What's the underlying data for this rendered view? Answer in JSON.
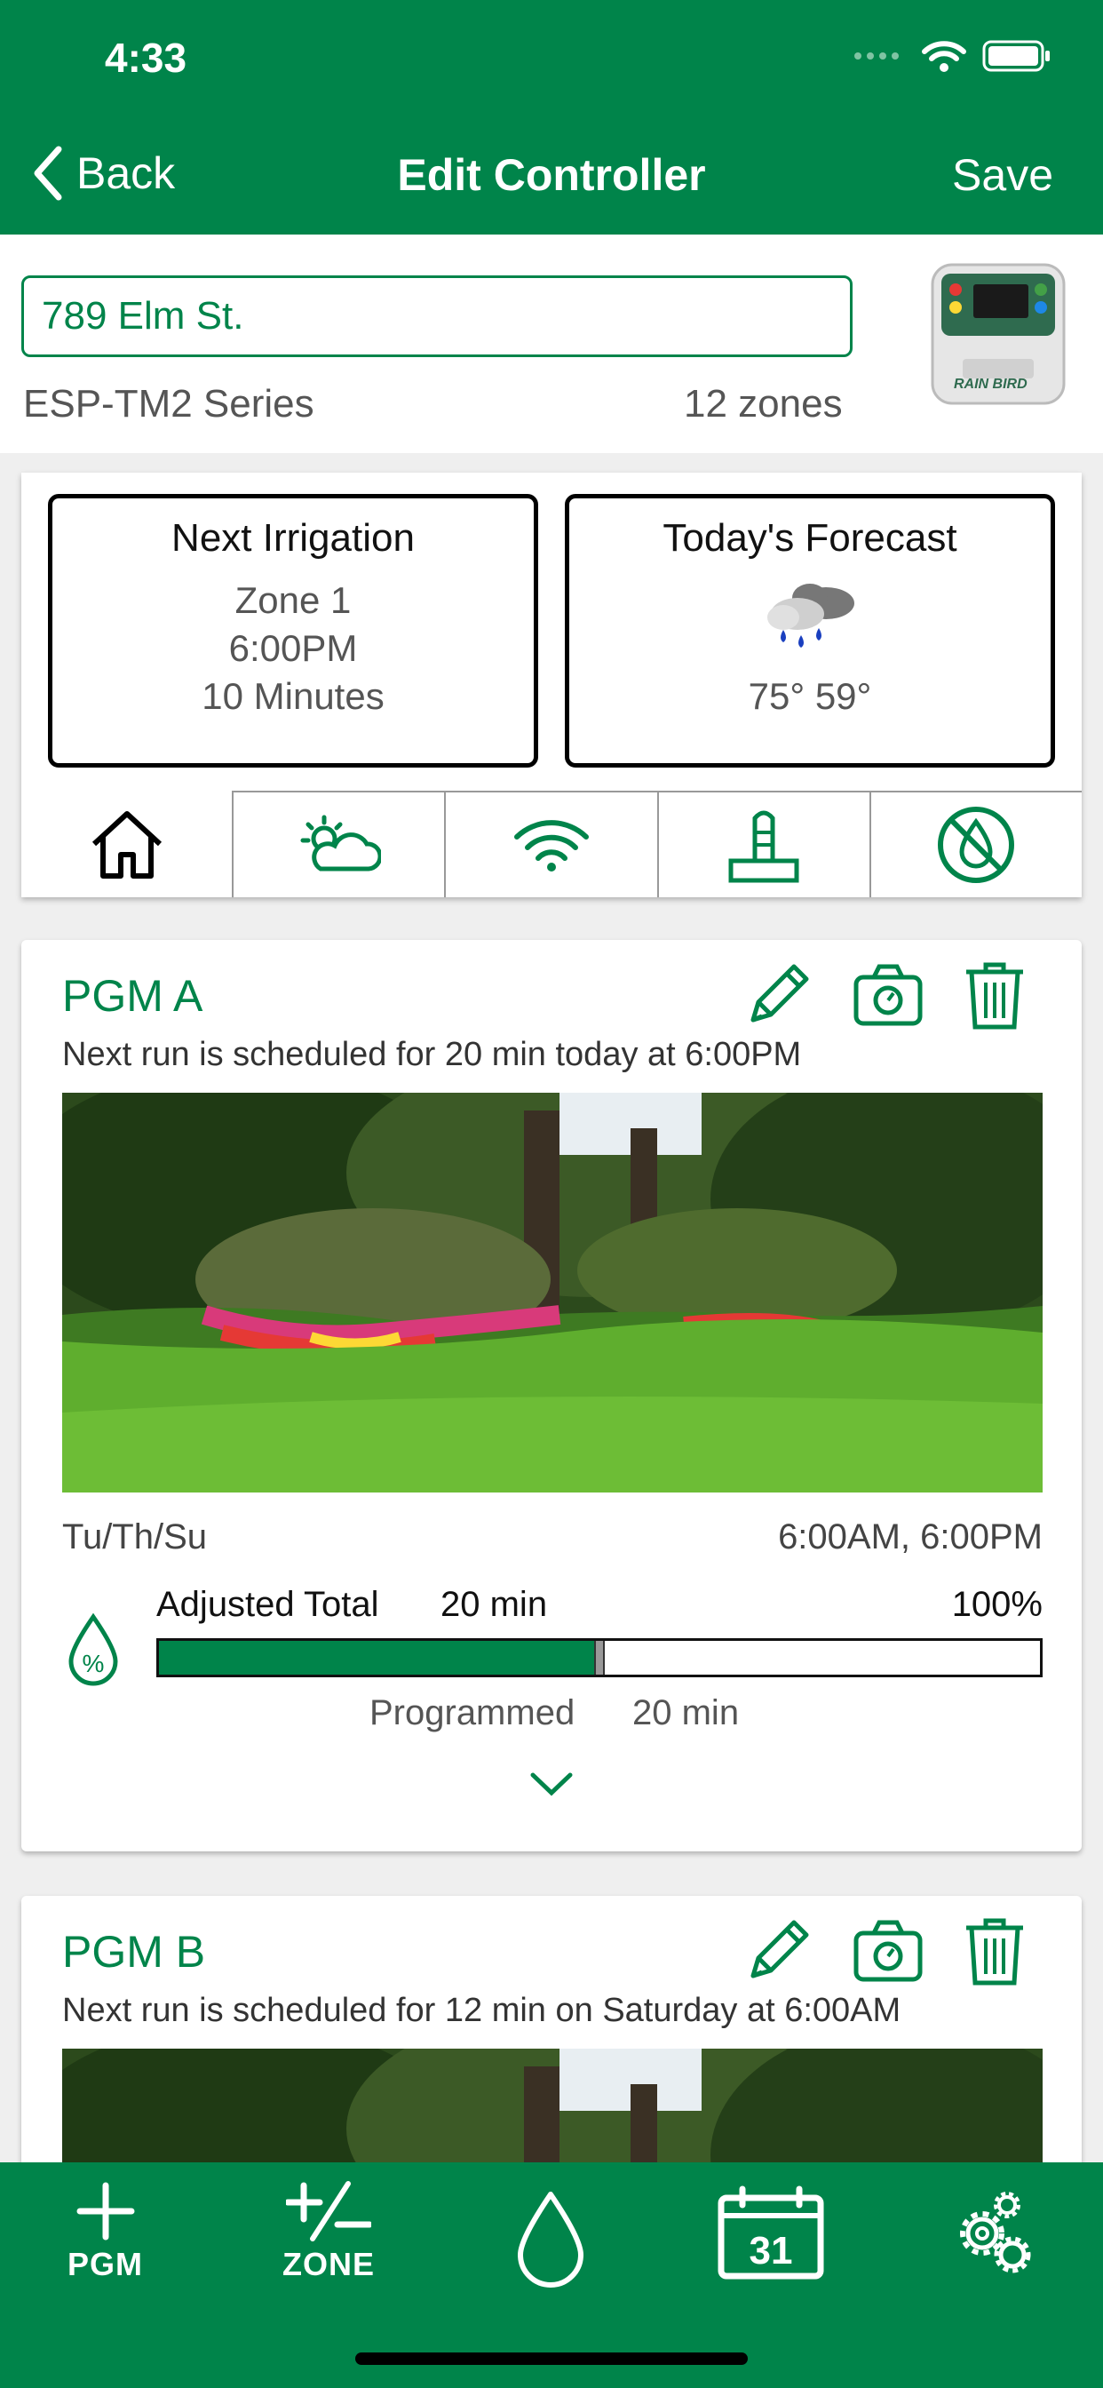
{
  "status_bar": {
    "time": "4:33"
  },
  "nav": {
    "back_label": "Back",
    "title": "Edit Controller",
    "save_label": "Save"
  },
  "controller": {
    "name_value": "789 Elm St.",
    "series": "ESP-TM2 Series",
    "zones": "12 zones",
    "device_brand": "RAIN BIRD"
  },
  "next_irrigation": {
    "title": "Next Irrigation",
    "zone": "Zone 1",
    "time": "6:00PM",
    "duration": "10 Minutes"
  },
  "forecast": {
    "title": "Today's Forecast",
    "icon": "rain-cloud-icon",
    "temps": "75° 59°"
  },
  "tabs": [
    {
      "icon": "home-icon",
      "active": true
    },
    {
      "icon": "weather-icon"
    },
    {
      "icon": "wifi-icon"
    },
    {
      "icon": "sensor-icon"
    },
    {
      "icon": "no-water-icon"
    }
  ],
  "programs": [
    {
      "name": "PGM A",
      "next_run": "Next run is scheduled for 20 min today at 6:00PM",
      "days": "Tu/Th/Su",
      "start_times": "6:00AM, 6:00PM",
      "adjusted_label": "Adjusted Total",
      "adjusted_value": "20 min",
      "percent": "100%",
      "fill_fraction": 0.5,
      "programmed_label": "Programmed",
      "programmed_value": "20 min"
    },
    {
      "name": "PGM B",
      "next_run": "Next run is scheduled for 12 min on Saturday at 6:00AM"
    }
  ],
  "toolbar": {
    "pgm_label": "PGM",
    "zone_label": "ZONE",
    "calendar_day": "31"
  },
  "colors": {
    "brand_green": "#00844a"
  }
}
